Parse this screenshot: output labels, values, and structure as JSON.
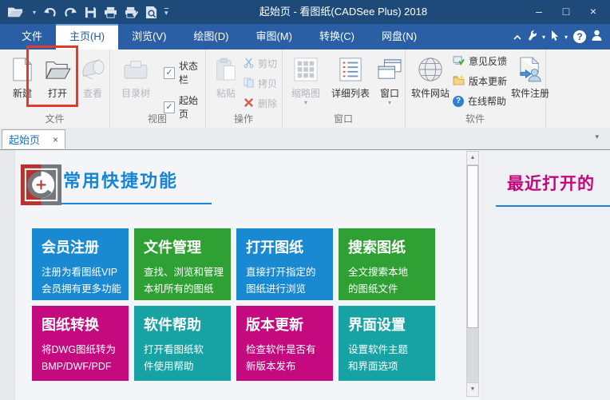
{
  "window": {
    "title": "起始页 - 看图纸(CADSee Plus) 2018",
    "minimize_glyph": "–",
    "maximize_glyph": "□",
    "close_glyph": "×"
  },
  "quick_access": {
    "icons": [
      "open-folder",
      "undo",
      "redo",
      "save",
      "print",
      "print-verify",
      "print-preview"
    ],
    "dropdown_caret": "▾",
    "overflow_caret": "▾"
  },
  "menubar": {
    "tabs": [
      "文件",
      "主页(H)",
      "浏览(V)",
      "绘图(D)",
      "审图(M)",
      "转换(C)",
      "网盘(N)"
    ],
    "active_tab": "主页(H)",
    "right_icons": [
      "collapse-ribbon",
      "tools",
      "pointer",
      "help",
      "account"
    ],
    "caret": "▾",
    "help_glyph": "?"
  },
  "ribbon": {
    "file_group": {
      "label": "文件",
      "new": "新建",
      "open": "打开",
      "view": "查看"
    },
    "view_group": {
      "label": "视图",
      "tree": "目录树",
      "statusbar": "状态栏",
      "startpage": "起始页",
      "check_glyph": "✓"
    },
    "ops_group": {
      "label": "操作",
      "paste": "粘贴",
      "cut": "剪切",
      "copy": "拷贝",
      "delete": "删除"
    },
    "window_group": {
      "label": "窗口",
      "thumbnails": "缩略图",
      "detail_list": "详细列表",
      "window": "窗口",
      "caret": "▾"
    },
    "software_group": {
      "label": "软件",
      "website": "软件网站",
      "feedback": "意见反馈",
      "update": "版本更新",
      "online_help": "在线帮助",
      "register": "软件注册"
    }
  },
  "tabbar": {
    "active_tab": "起始页",
    "close_glyph": "×",
    "caret": "▾"
  },
  "content": {
    "left": {
      "heading": "常用快捷功能",
      "tiles": [
        {
          "title": "会员注册",
          "line1": "注册为看图纸VIP",
          "line2": "会员拥有更多功能",
          "color": "#1989d1"
        },
        {
          "title": "文件管理",
          "line1": "查找、浏览和管理",
          "line2": "本机所有的图纸",
          "color": "#2fa033"
        },
        {
          "title": "打开图纸",
          "line1": "直接打开指定的",
          "line2": "图纸进行浏览",
          "color": "#1989d1"
        },
        {
          "title": "搜索图纸",
          "line1": "全文搜索本地",
          "line2": "的图纸文件",
          "color": "#2fa033"
        },
        {
          "title": "图纸转换",
          "line1": "将DWG图纸转为",
          "line2": "BMP/DWF/PDF",
          "color": "#c40a7e"
        },
        {
          "title": "软件帮助",
          "line1": "打开看图纸软",
          "line2": "件使用帮助",
          "color": "#17a2a3"
        },
        {
          "title": "版本更新",
          "line1": "检查软件是否有",
          "line2": "新版本发布",
          "color": "#c40a7e"
        },
        {
          "title": "界面设置",
          "line1": "设置软件主题",
          "line2": "和界面选项",
          "color": "#17a2a3"
        }
      ]
    },
    "right": {
      "heading": "最近打开的"
    }
  },
  "scrollbar": {
    "up_glyph": "▲",
    "down_glyph": "▼"
  },
  "annotation": {
    "shape": "rectangle",
    "color": "#e23a2c",
    "target": "open-button"
  },
  "colors": {
    "titlebar": "#1e4a79",
    "menubar": "#2a5fa5",
    "ribbon_bg": "#f2f2f3",
    "accent_blue": "#1583d6",
    "recent_heading": "#c2077c",
    "tile_blue": "#1989d1",
    "tile_green": "#2fa033",
    "tile_magenta": "#c40a7e",
    "tile_teal": "#17a2a3"
  }
}
